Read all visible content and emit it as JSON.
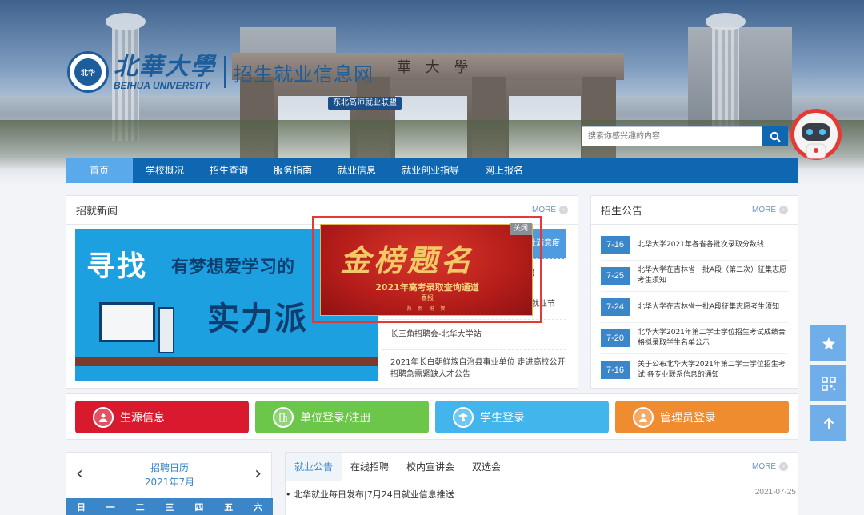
{
  "header": {
    "logo_cn": "北華大學",
    "logo_en": "BEIHUA UNIVERSITY",
    "site_name": "招生就业信息网",
    "alliance": "东北高师就业联盟",
    "gate_text": "華 大 學",
    "search_placeholder": "搜索你感兴趣的内容"
  },
  "nav": [
    "首页",
    "学校概况",
    "招生查询",
    "服务指南",
    "就业信息",
    "就业创业指导",
    "网上报名"
  ],
  "news": {
    "title": "招就新闻",
    "more": "MORE",
    "banner_line1": "寻找",
    "banner_line2": "有梦想爱学习的",
    "banner_line3": "实力派",
    "items": [
      "关单位 就业满意度",
      "招聘",
      "就业节",
      "长三角招聘会-北华大学站",
      "2021年长白朝鲜族自治县事业单位 走进高校公开招聘急需紧缺人才公告"
    ]
  },
  "popup": {
    "close": "关闭",
    "headline": "金榜题名",
    "subtitle": "2021年高考录取查询通道",
    "tag": "喜报",
    "footer": "热 烈 祝 贺"
  },
  "announcements": {
    "title": "招生公告",
    "more": "MORE",
    "items": [
      {
        "date": "7-16",
        "text": "北华大学2021年各省各批次录取分数线"
      },
      {
        "date": "7-25",
        "text": "北华大学在吉林省一批A段（第二次）征集志愿考生须知"
      },
      {
        "date": "7-24",
        "text": "北华大学在吉林省一批A段征集志愿考生须知"
      },
      {
        "date": "7-20",
        "text": "北华大学2021年第二学士学位招生考试成绩合格拟录取学生名单公示"
      },
      {
        "date": "7-16",
        "text": "关于公布北华大学2021年第二学士学位招生考试 各专业联系信息的通知"
      }
    ]
  },
  "quick": [
    {
      "label": "生源信息",
      "color": "#d9192e"
    },
    {
      "label": "单位登录/注册",
      "color": "#6cc64a"
    },
    {
      "label": "学生登录",
      "color": "#41b5ec"
    },
    {
      "label": "管理员登录",
      "color": "#f08c30"
    }
  ],
  "calendar": {
    "title": "招聘日历",
    "month": "2021年7月",
    "weekdays": [
      "日",
      "一",
      "二",
      "三",
      "四",
      "五",
      "六"
    ]
  },
  "employment": {
    "tabs": [
      "就业公告",
      "在线招聘",
      "校内宣讲会",
      "双选会"
    ],
    "more": "MORE",
    "first_item": "北华就业每日发布|7月24日就业信息推送",
    "first_date": "2021-07-25"
  }
}
